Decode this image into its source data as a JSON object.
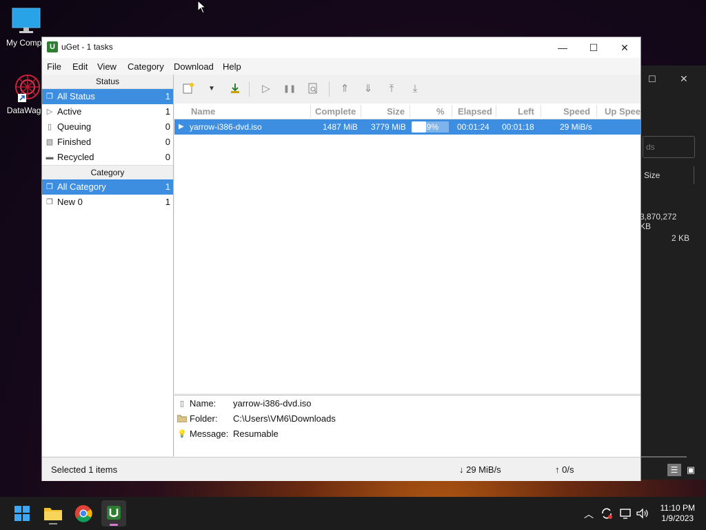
{
  "desktop": {
    "icons": [
      {
        "label": "My Compu",
        "icon": "monitor-icon"
      },
      {
        "label": "DataWago",
        "icon": "datawago-icon"
      }
    ]
  },
  "background_window": {
    "search_placeholder": "ds",
    "column_size": "Size",
    "values": [
      "3,870,272 KB",
      "2 KB"
    ]
  },
  "window": {
    "title": "uGet - 1 tasks",
    "controls": {
      "minimize": "—",
      "maximize": "☐",
      "close": "✕"
    }
  },
  "menu": [
    "File",
    "Edit",
    "View",
    "Category",
    "Download",
    "Help"
  ],
  "sidebar": {
    "status_header": "Status",
    "status_items": [
      {
        "label": "All Status",
        "count": "1"
      },
      {
        "label": "Active",
        "count": "1"
      },
      {
        "label": "Queuing",
        "count": "0"
      },
      {
        "label": "Finished",
        "count": "0"
      },
      {
        "label": "Recycled",
        "count": "0"
      }
    ],
    "category_header": "Category",
    "category_items": [
      {
        "label": "All Category",
        "count": "1"
      },
      {
        "label": "New 0",
        "count": "1"
      }
    ]
  },
  "list": {
    "columns": [
      "Name",
      "Complete",
      "Size",
      "%",
      "Elapsed",
      "Left",
      "Speed",
      "Up Spee"
    ],
    "rows": [
      {
        "name": "yarrow-i386-dvd.iso",
        "complete": "1487 MiB",
        "size": "3779 MiB",
        "percent_text": "39%",
        "progress": 0.39,
        "elapsed": "00:01:24",
        "left": "00:01:18",
        "speed": "29 MiB/s"
      }
    ]
  },
  "details": {
    "name_label": "Name:",
    "name_value": "yarrow-i386-dvd.iso",
    "folder_label": "Folder:",
    "folder_value": "C:\\Users\\VM6\\Downloads",
    "message_label": "Message:",
    "message_value": "Resumable"
  },
  "statusbar": {
    "selected": "Selected 1 items",
    "down_speed": "↓ 29 MiB/s",
    "up_speed": "↑ 0/s"
  },
  "taskbar": {
    "time": "11:10 PM",
    "date": "1/9/2023"
  },
  "colors": {
    "selection": "#3d8ee0",
    "taskbar": "#1c1c1c"
  }
}
